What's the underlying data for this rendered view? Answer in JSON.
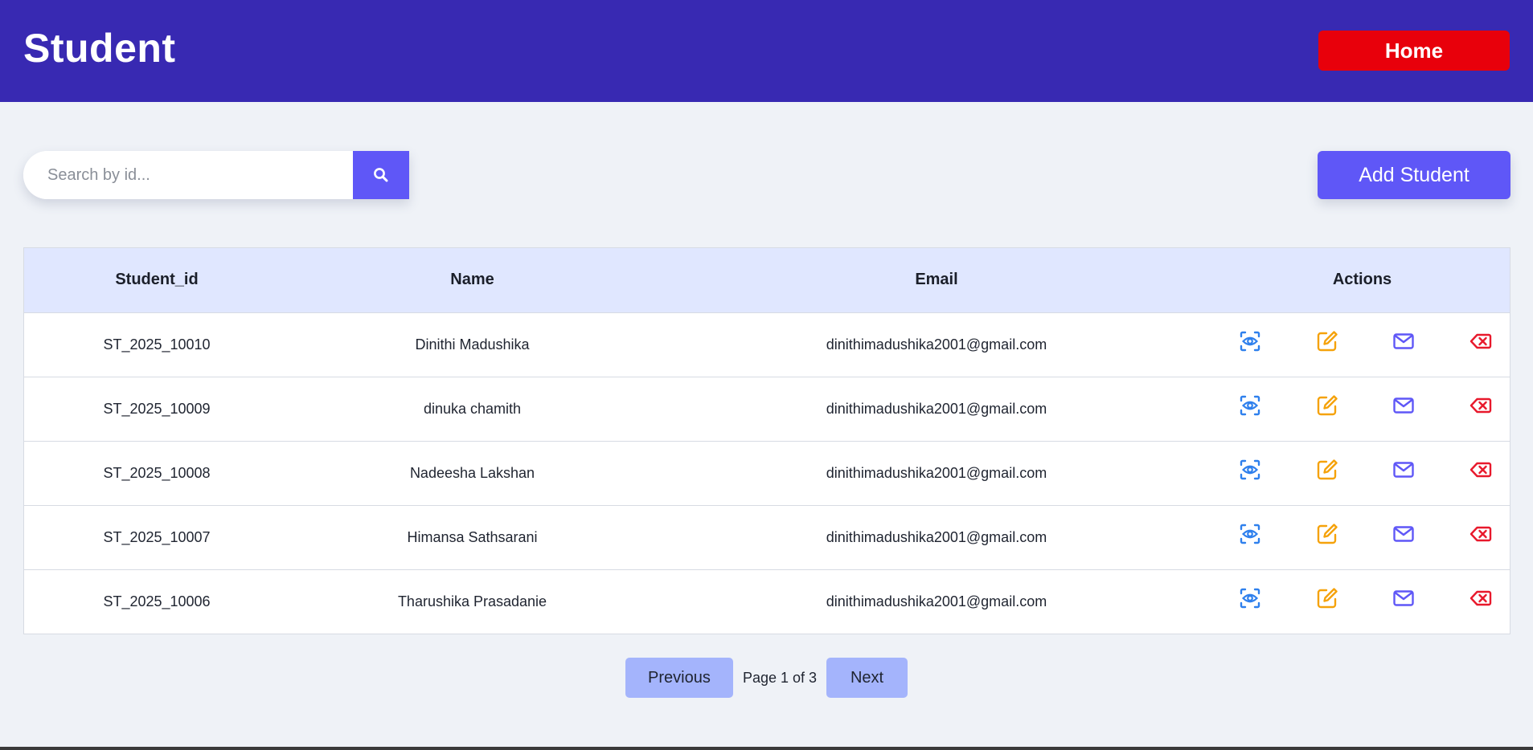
{
  "header": {
    "title": "Student",
    "home_label": "Home"
  },
  "search": {
    "placeholder": "Search by id...",
    "value": "",
    "icon": "search-icon"
  },
  "toolbar": {
    "add_label": "Add Student"
  },
  "table": {
    "columns": [
      "Student_id",
      "Name",
      "Email",
      "Actions"
    ],
    "rows": [
      {
        "id": "ST_2025_10010",
        "name": "Dinithi Madushika",
        "email": "dinithimadushika2001@gmail.com"
      },
      {
        "id": "ST_2025_10009",
        "name": "dinuka chamith",
        "email": "dinithimadushika2001@gmail.com"
      },
      {
        "id": "ST_2025_10008",
        "name": "Nadeesha Lakshan",
        "email": "dinithimadushika2001@gmail.com"
      },
      {
        "id": "ST_2025_10007",
        "name": "Himansa Sathsarani",
        "email": "dinithimadushika2001@gmail.com"
      },
      {
        "id": "ST_2025_10006",
        "name": "Tharushika Prasadanie",
        "email": "dinithimadushika2001@gmail.com"
      }
    ],
    "action_icons": [
      "view-icon",
      "edit-icon",
      "mail-icon",
      "delete-icon"
    ]
  },
  "pagination": {
    "prev_label": "Previous",
    "next_label": "Next",
    "page_info": "Page 1 of 3"
  },
  "colors": {
    "header_bg": "#3829b2",
    "home_button": "#e8000b",
    "primary": "#5f57f7",
    "table_header_bg": "#e0e7ff",
    "pagination_button": "#a4b4fc",
    "view_icon": "#2f80ed",
    "edit_icon": "#f5a20a",
    "mail_icon": "#5f57f7",
    "delete_icon": "#e8192c"
  }
}
